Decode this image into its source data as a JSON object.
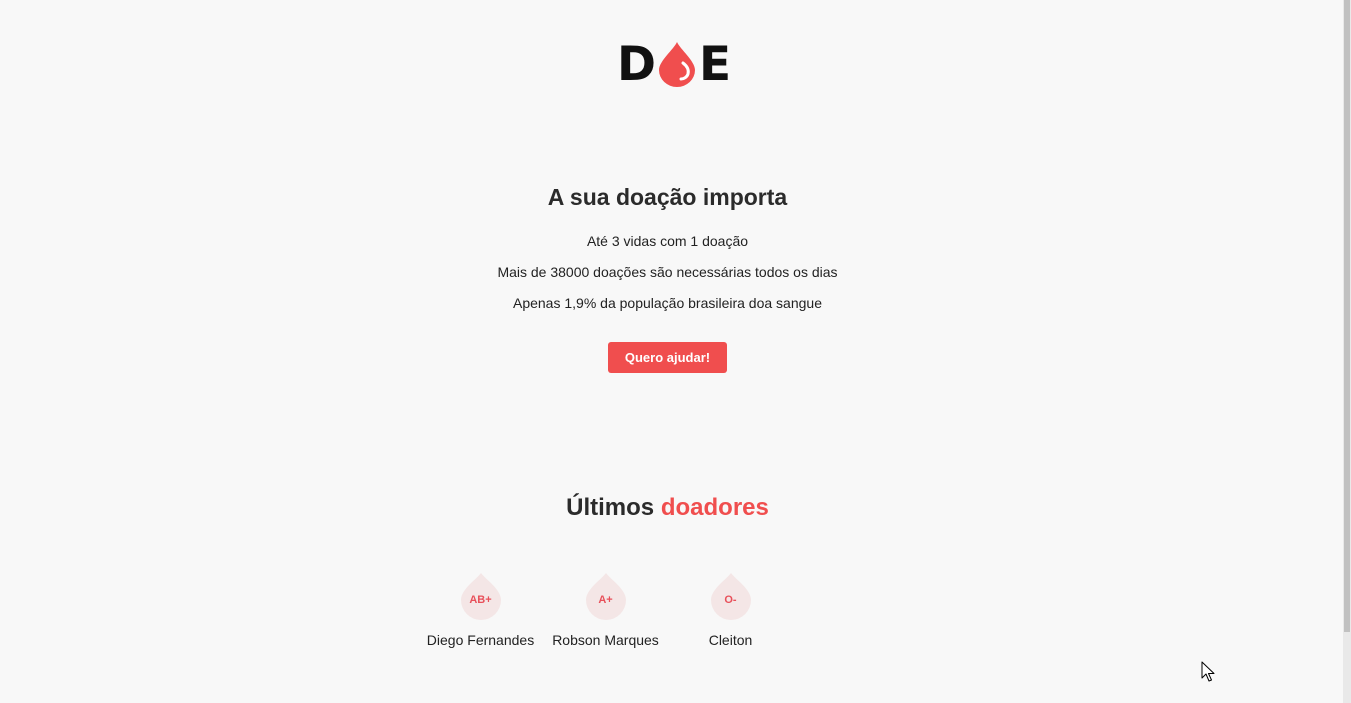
{
  "logo": {
    "left": "D",
    "right": "E",
    "icon": "blood-drop-icon",
    "accent_color": "#f04e4e"
  },
  "hero": {
    "title": "A sua doação importa",
    "facts": [
      "Até 3 vidas com 1 doação",
      "Mais de 38000 doações são necessárias todos os dias",
      "Apenas 1,9% da população brasileira doa sangue"
    ],
    "cta_label": "Quero ajudar!"
  },
  "donors": {
    "title_plain": "Últimos",
    "title_accent": "doadores",
    "items": [
      {
        "blood_type": "AB+",
        "name": "Diego Fernandes"
      },
      {
        "blood_type": "A+",
        "name": "Robson Marques"
      },
      {
        "blood_type": "O-",
        "name": "Cleiton"
      }
    ]
  },
  "colors": {
    "accent": "#f04e4e",
    "background": "#f8f8f8",
    "text": "#222222",
    "badge_bg": "#f4e6e6"
  }
}
